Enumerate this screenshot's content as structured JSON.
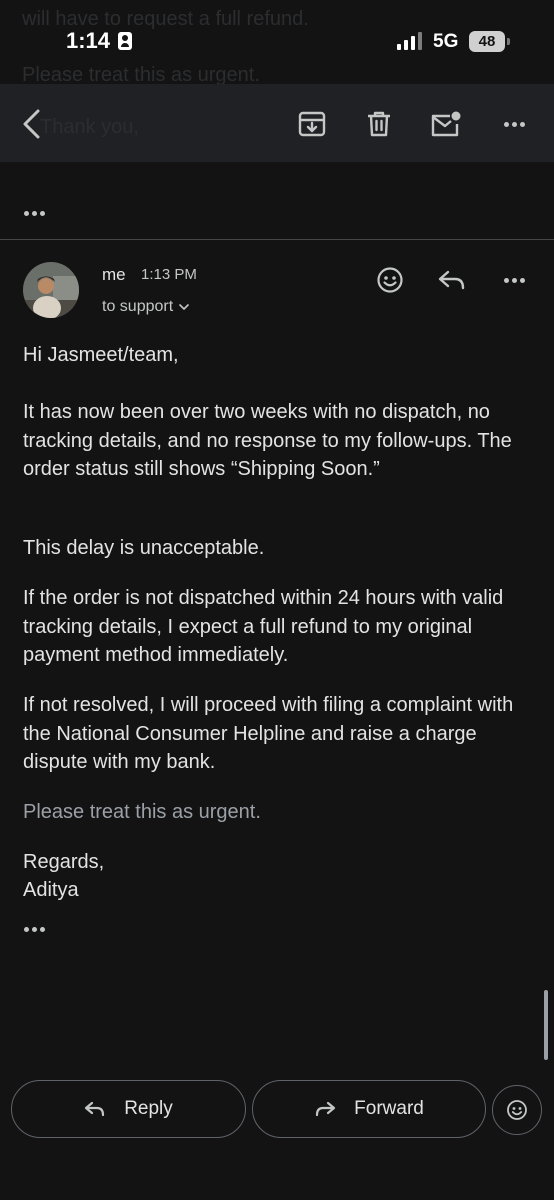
{
  "status_bar": {
    "time": "1:14",
    "network": "5G",
    "battery": "48"
  },
  "background_preview": {
    "line1": "will have to request a full refund.",
    "line2": "Please treat this as urgent.",
    "line3": "Thank you,"
  },
  "toolbar": {
    "back_icon": "chevron-left-icon",
    "archive_icon": "archive-icon",
    "delete_icon": "trash-icon",
    "unread_icon": "mark-unread-icon",
    "more_icon": "more-horizontal-icon"
  },
  "message": {
    "sender": "me",
    "time": "1:13 PM",
    "recipient": "to support",
    "greeting": "Hi Jasmeet/team,",
    "paragraphs": [
      "It has now been over two weeks with no dispatch, no tracking details, and no response to my follow-ups. The order status still shows “Shipping Soon.”",
      "This delay is unacceptable.",
      "If the order is not dispatched within 24 hours with valid tracking details, I expect a full refund to my original payment method immediately.",
      "If not resolved, I will proceed with filing a complaint with the National Consumer Helpline and raise a charge dispute with my bank."
    ],
    "urgent_line": "Please treat this as urgent.",
    "closing": "Regards,",
    "signature": "Aditya"
  },
  "actions": {
    "reply": "Reply",
    "forward": "Forward"
  },
  "colors": {
    "background": "#131314",
    "toolbar": "#202124",
    "text": "#e3e3e3",
    "muted": "#9aa0a6"
  }
}
